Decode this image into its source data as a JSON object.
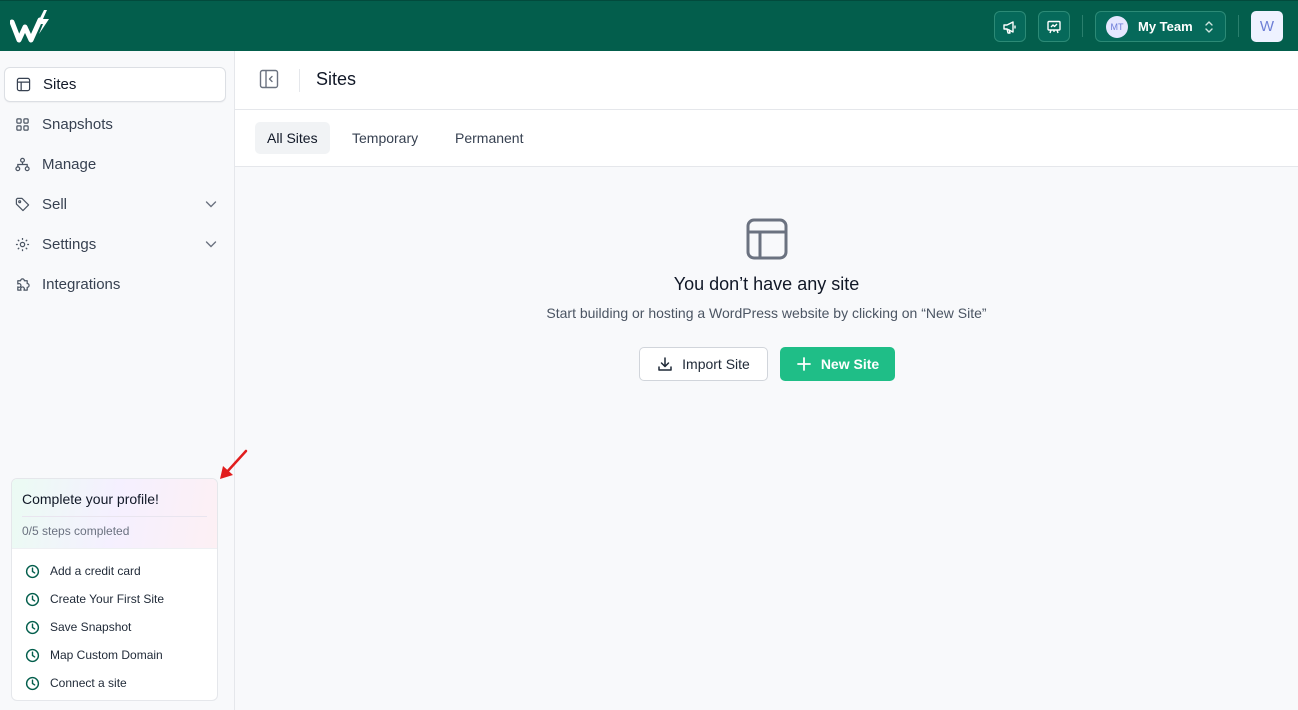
{
  "topbar": {
    "logo_icon": "brand-logo",
    "announcement_icon": "megaphone-icon",
    "presentation_icon": "presentation-icon",
    "team": {
      "initials": "MT",
      "name": "My Team"
    },
    "user_initial": "W"
  },
  "sidebar": {
    "items": [
      {
        "label": "Sites",
        "icon": "layout-icon",
        "active": true
      },
      {
        "label": "Snapshots",
        "icon": "grid-icon"
      },
      {
        "label": "Manage",
        "icon": "sitemap-icon"
      },
      {
        "label": "Sell",
        "icon": "tag-icon",
        "expandable": true
      },
      {
        "label": "Settings",
        "icon": "gear-icon",
        "expandable": true
      },
      {
        "label": "Integrations",
        "icon": "puzzle-icon"
      }
    ]
  },
  "profile_card": {
    "title": "Complete your profile!",
    "progress": "0/5 steps completed",
    "steps": [
      "Add a credit card",
      "Create Your First Site",
      "Save Snapshot",
      "Map Custom Domain",
      "Connect a site"
    ]
  },
  "header": {
    "title": "Sites"
  },
  "tabs": [
    {
      "label": "All Sites",
      "active": true
    },
    {
      "label": "Temporary"
    },
    {
      "label": "Permanent"
    }
  ],
  "empty_state": {
    "title": "You don’t have any site",
    "subtitle": "Start building or hosting a WordPress website by clicking on “New Site”",
    "import_label": "Import Site",
    "new_label": "New Site"
  },
  "colors": {
    "brand": "#035e4c",
    "accent": "#1fbe87",
    "annotation_arrow": "#e11d1d"
  }
}
